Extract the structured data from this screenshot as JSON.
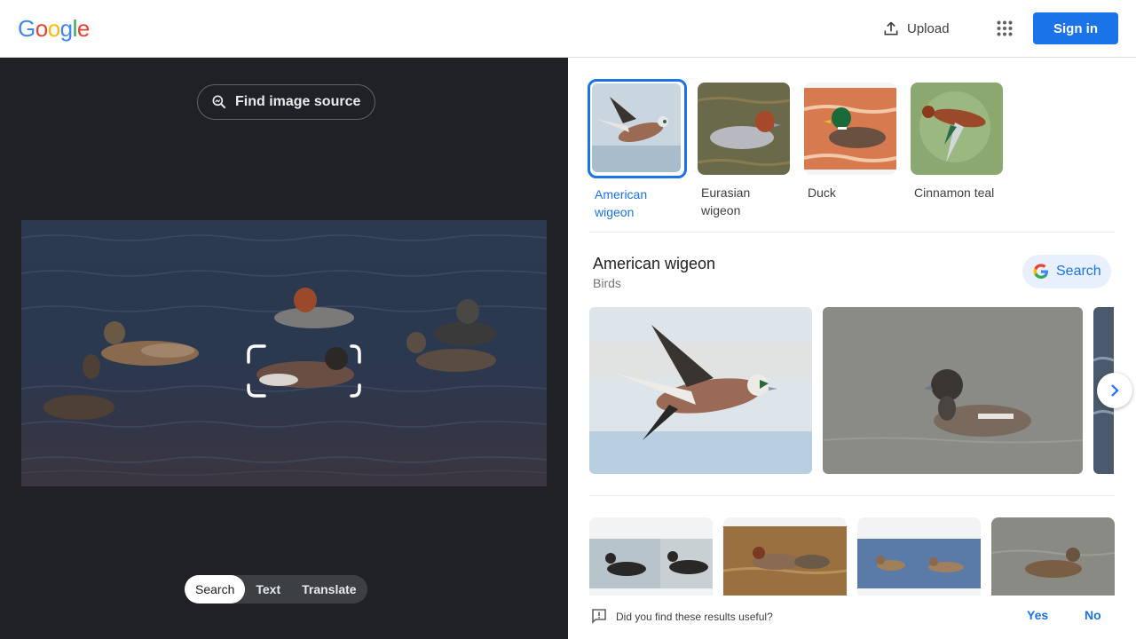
{
  "header": {
    "logo_letters": [
      {
        "ch": "G",
        "color": "#4285f4"
      },
      {
        "ch": "o",
        "color": "#ea4335"
      },
      {
        "ch": "o",
        "color": "#fbbc05"
      },
      {
        "ch": "g",
        "color": "#4285f4"
      },
      {
        "ch": "l",
        "color": "#34a853"
      },
      {
        "ch": "e",
        "color": "#ea4335"
      }
    ],
    "upload_label": "Upload",
    "signin_label": "Sign in"
  },
  "left": {
    "find_source_label": "Find image source",
    "modes": [
      "Search",
      "Text",
      "Translate"
    ],
    "active_mode": "Search"
  },
  "right": {
    "chips": [
      {
        "label": "American wigeon",
        "selected": true
      },
      {
        "label": "Eurasian wigeon",
        "selected": false
      },
      {
        "label": "Duck",
        "selected": false
      },
      {
        "label": "Cinnamon teal",
        "selected": false
      }
    ],
    "result_title": "American wigeon",
    "result_subtitle": "Birds",
    "search_label": "Search",
    "feedback_question": "Did you find these results useful?",
    "feedback_yes": "Yes",
    "feedback_no": "No"
  },
  "colors": {
    "accent": "#1a73e8",
    "dark_bg": "#202124"
  }
}
